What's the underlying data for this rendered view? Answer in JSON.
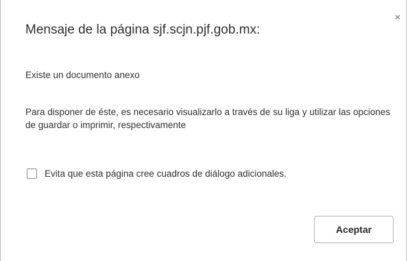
{
  "dialog": {
    "title": "Mensaje de la página sjf.scjn.pjf.gob.mx:",
    "close_glyph": "×",
    "message_line_1": "Existe un documento anexo",
    "message_line_2": "Para disponer de éste, es necesario visualizarlo a través de su liga y utilizar las opciones de guardar o imprimir, respectivamente",
    "suppress_checkbox_label": "Evita que esta página cree cuadros de diálogo adicionales.",
    "suppress_checkbox_checked": false,
    "accept_button_label": "Aceptar"
  },
  "icons": {
    "close": "close-icon"
  }
}
